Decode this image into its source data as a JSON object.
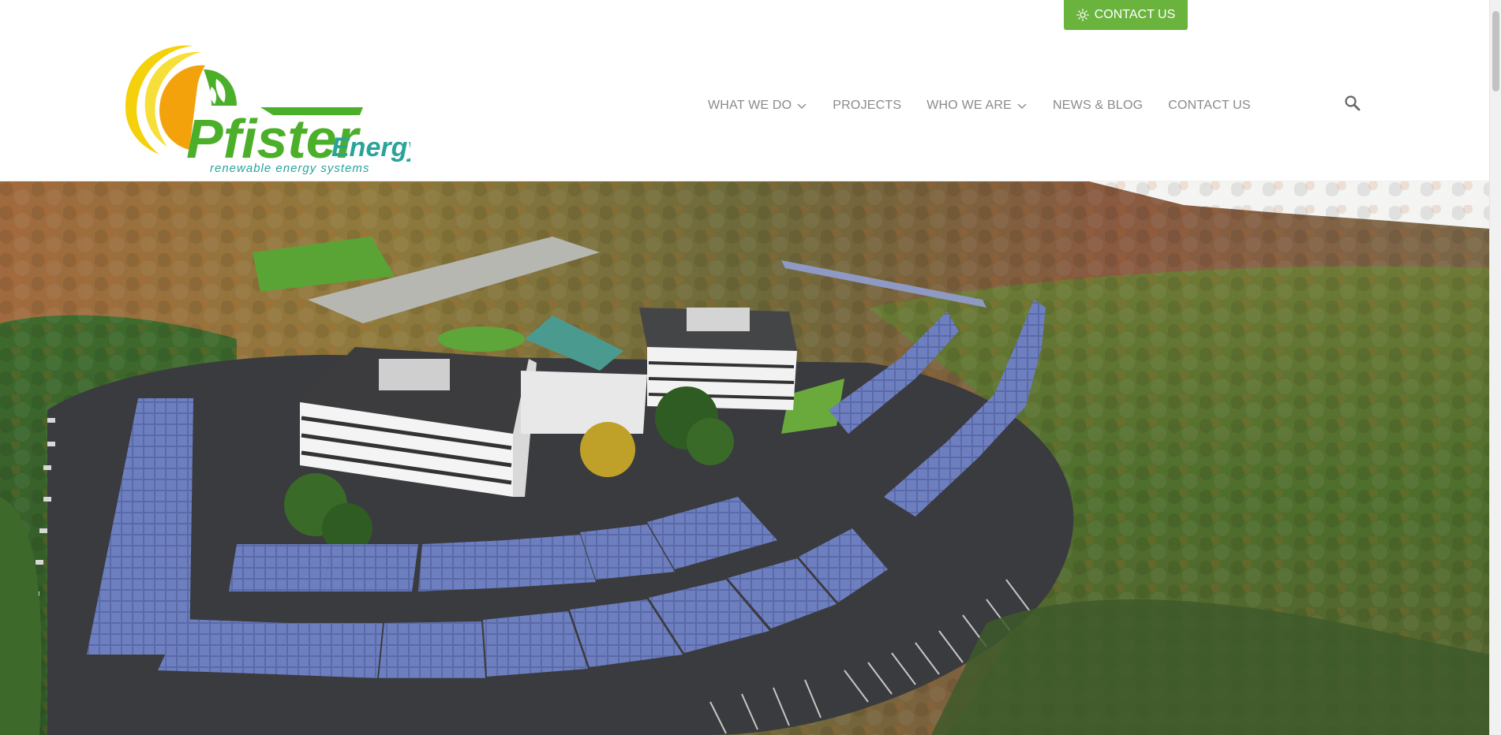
{
  "header": {
    "cta_button": "CONTACT US",
    "logo": {
      "brand": "Pfister",
      "brand_suffix": "Energy",
      "tagline": "renewable energy systems"
    },
    "nav": [
      {
        "label": "WHAT WE DO",
        "has_dropdown": true
      },
      {
        "label": "PROJECTS",
        "has_dropdown": false
      },
      {
        "label": "WHO WE ARE",
        "has_dropdown": true
      },
      {
        "label": "NEWS & BLOG",
        "has_dropdown": false
      },
      {
        "label": "CONTACT US",
        "has_dropdown": false
      }
    ],
    "search_icon": "search-icon"
  },
  "hero": {
    "image": "aerial view of office campus with solar carport arrays surrounded by autumn forest"
  },
  "colors": {
    "brand_green": "#6ab43e",
    "logo_green": "#4caf2a",
    "logo_teal": "#2aa39a",
    "sun_yellow": "#f5d10b",
    "sun_orange": "#f3a20c",
    "nav_gray": "#8a8a8a"
  }
}
